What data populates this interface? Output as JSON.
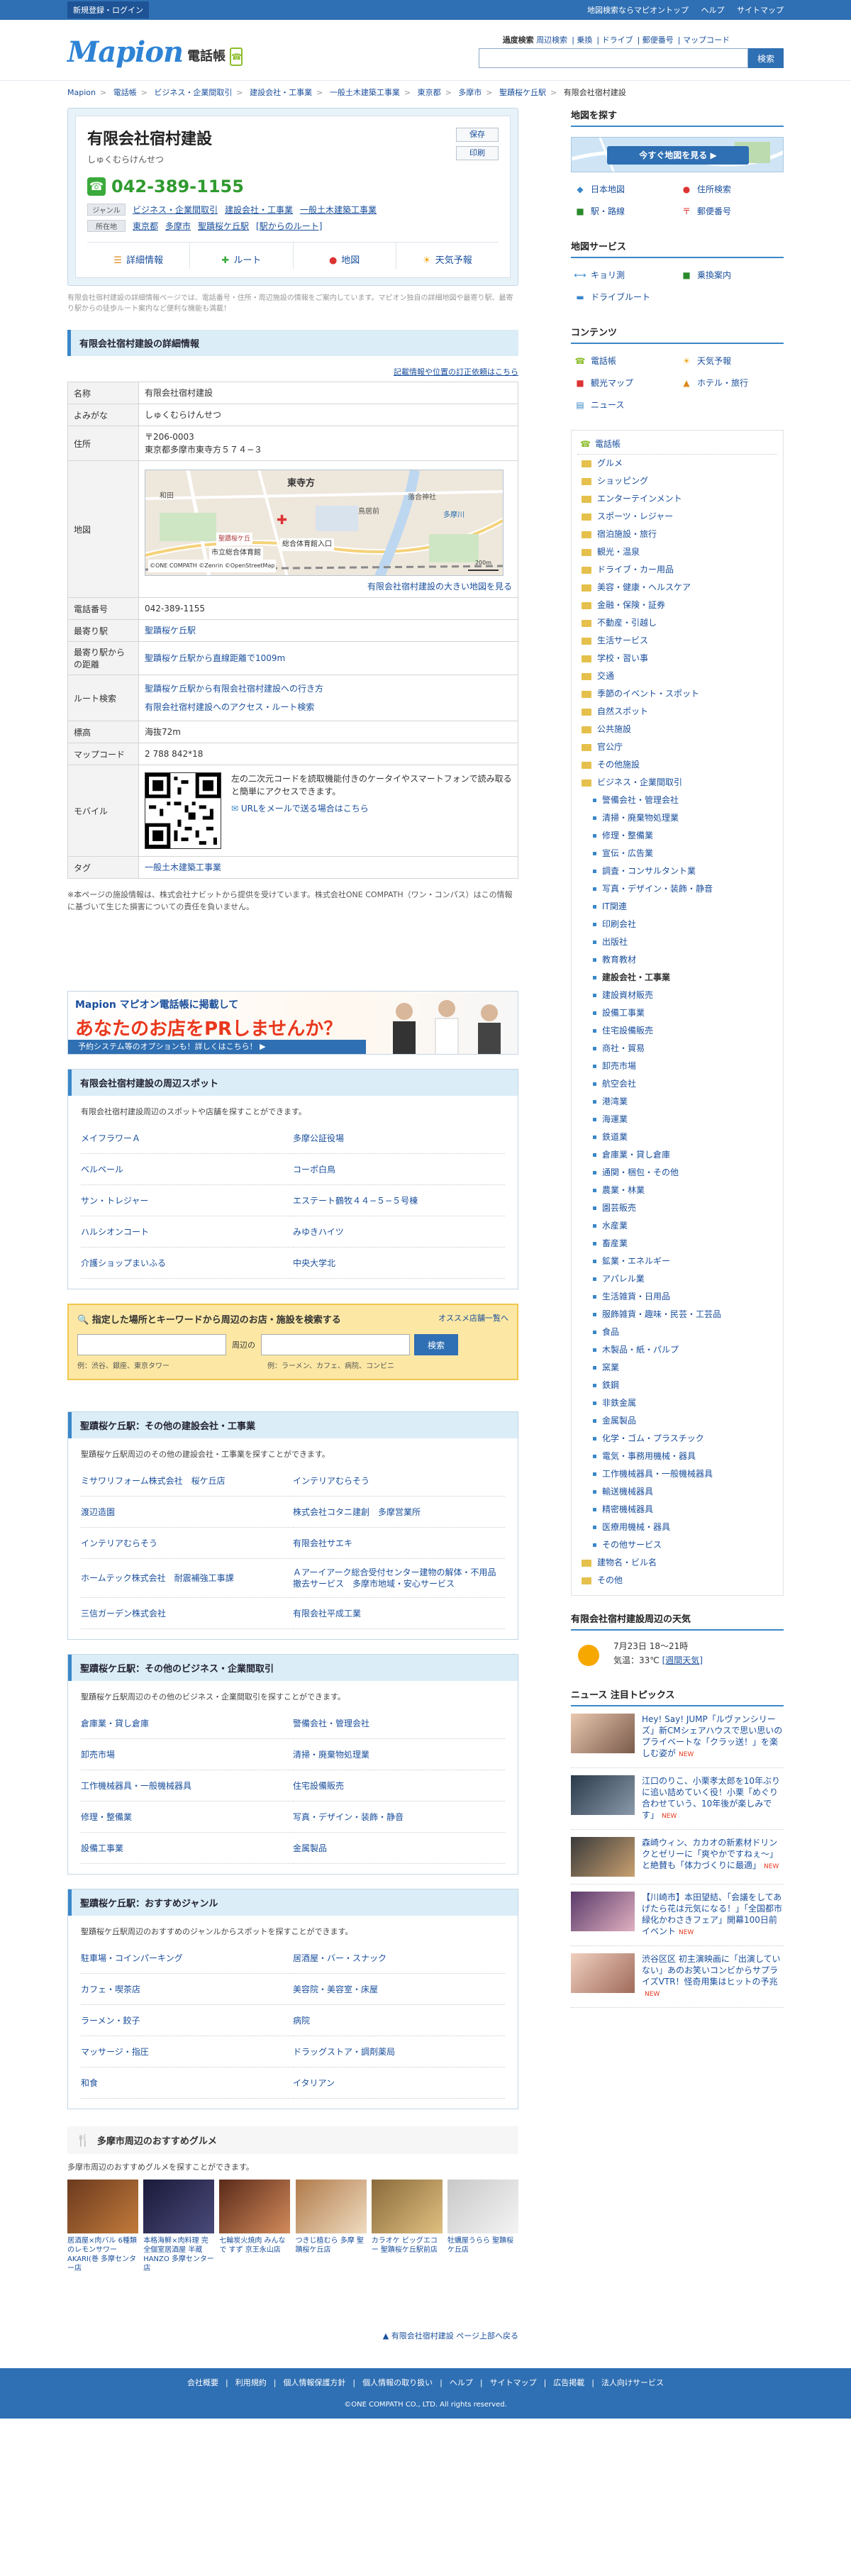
{
  "topbar": {
    "login": "新規登録・ログイン",
    "links": [
      "地図検索ならマピオントップ",
      "ヘルプ",
      "サイトマップ"
    ]
  },
  "header": {
    "logo": "Mapion",
    "logo_sub": "電話帳",
    "links_label": "過度検索",
    "links": [
      "周辺検索",
      "乗換",
      "ドライブ",
      "郵便番号",
      "マップコード"
    ],
    "search_placeholder": "",
    "search_button": "検索"
  },
  "breadcrumb": [
    "Mapion",
    "電話帳",
    "ビジネス・企業間取引",
    "建設会社・工事業",
    "一般土木建築工事業",
    "東京都",
    "多摩市",
    "聖蹟桜ケ丘駅",
    "有限会社宿村建設"
  ],
  "company": {
    "name": "有限会社宿村建設",
    "kana": "しゅくむらけんせつ",
    "save": "保存",
    "print": "印刷",
    "tel": "042-389-1155",
    "genre_tag": "ジャンル",
    "genres": [
      "ビジネス・企業間取引",
      "建設会社・工事業",
      "一般土木建築工事業"
    ],
    "address_tag": "所在地",
    "address_links": [
      "東京都",
      "多摩市",
      "聖蹟桜ケ丘駅",
      "[駅からのルート]"
    ],
    "actions": [
      "詳細情報",
      "ルート",
      "地図",
      "天気予報"
    ]
  },
  "note": "有限会社宿村建設の詳細情報ページでは、電話番号・住所・周辺施設の情報をご案内しています。マピオン独自の詳細地図や最寄り駅、最寄り駅からの徒歩ルート案内など便利な機能も満載！",
  "detail": {
    "title": "有限会社宿村建設の詳細情報",
    "correction_link": "記載情報や位置の訂正依頼はこちら",
    "rows": {
      "name_label": "名称",
      "name": "有限会社宿村建設",
      "kana_label": "よみがな",
      "kana": "しゅくむらけんせつ",
      "addr_label": "住所",
      "zip": "〒206-0003",
      "addr": "東京都多摩市東寺方５７４−３",
      "map_label": "地図",
      "map_link": "有限会社宿村建設の大きい地図を見る",
      "map_place1": "東寺方",
      "map_place2": "鳥居前",
      "map_place3": "落合神社",
      "map_place4": "多摩川",
      "map_place5": "和田",
      "map_pin": "東寺方",
      "map_route": "聖蹟桜ケ丘",
      "map_poi1": "市立総合体育館",
      "map_poi2": "総合体育館入口",
      "map_copy": "©ONE COMPATH ©Zenrin ©OpenStreetMap",
      "map_scale": "200m",
      "tel_label": "電話番号",
      "tel": "042-389-1155",
      "station_label": "最寄り駅",
      "station": "聖蹟桜ケ丘駅",
      "dist_label": "最寄り駅からの距離",
      "dist": "聖蹟桜ケ丘駅から直線距離で1009m",
      "route_label": "ルート検索",
      "route1": "聖蹟桜ケ丘駅から有限会社宿村建設への行き方",
      "route2": "有限会社宿村建設へのアクセス・ルート検索",
      "alt_label": "標高",
      "alt": "海抜72m",
      "mapcode_label": "マップコード",
      "mapcode": "2 788 842*18",
      "mobile_label": "モバイル",
      "mobile_text": "左の二次元コードを読取機能付きのケータイやスマートフォンで読み取ると簡単にアクセスできます。",
      "mobile_mail": "URLをメールで送る場合はこちら",
      "tag_label": "タグ",
      "tag": "一般土木建築工事業"
    }
  },
  "disclaimer": "※本ページの施設情報は、株式会社ナビットから提供を受けています。株式会社ONE COMPATH（ワン・コンパス）はこの情報に基づいて生じた損害についての責任を負いません。",
  "pr": {
    "line1": "Mapion マピオン電話帳に掲載して",
    "line2": "あなたのお店をPRしませんか？",
    "line3": "予約システム等のオプションも！詳しくはこちら！ ▶"
  },
  "spots": {
    "title": "有限会社宿村建設の周辺スポット",
    "desc": "有限会社宿村建設周辺のスポットや店舗を探すことができます。",
    "items": [
      "メイフラワーＡ",
      "多摩公証役場",
      "ベルペール",
      "コーポ白鳥",
      "サン・トレジャー",
      "エステート鶴牧４４−５−５号棟",
      "ハルシオンコート",
      "みゆきハイツ",
      "介護ショップまいふる",
      "中央大学北"
    ]
  },
  "search": {
    "title": "指定した場所とキーワードから周辺のお店・施設を検索する",
    "more": "オススメ店舗一覧へ",
    "near": "周辺の",
    "button": "検索",
    "ex1": "例：渋谷、銀座、東京タワー",
    "ex2": "例：ラーメン、カフェ、病院、コンビニ"
  },
  "others_build": {
    "title": "聖蹟桜ケ丘駅：その他の建設会社・工事業",
    "desc": "聖蹟桜ケ丘駅周辺のその他の建設会社・工事業を探すことができます。",
    "items": [
      "ミサワリフォーム株式会社　桜ケ丘店",
      "インテリアむらそう",
      "渡辺造園",
      "株式会社コタニ建創　多摩営業所",
      "インテリアむらそう",
      "有限会社サエキ",
      "ホームテック株式会社　耐震補強工事課",
      "Ａアーイアーク総合受付センター建物の解体・不用品撤去サービス　多摩市地域・安心サービス",
      "三信ガーデン株式会社",
      "有限会社平成工業"
    ]
  },
  "others_biz": {
    "title": "聖蹟桜ケ丘駅：その他のビジネス・企業間取引",
    "desc": "聖蹟桜ケ丘駅周辺のその他のビジネス・企業間取引を探すことができます。",
    "items": [
      "倉庫業・貸し倉庫",
      "警備会社・管理会社",
      "卸売市場",
      "清掃・廃棄物処理業",
      "工作機械器具・一般機械器具",
      "住宅設備販売",
      "修理・整備業",
      "写真・デザイン・装飾・静音",
      "設備工事業",
      "金属製品"
    ]
  },
  "recommend": {
    "title": "聖蹟桜ケ丘駅：おすすめジャンル",
    "desc": "聖蹟桜ケ丘駅周辺のおすすめのジャンルからスポットを探すことができます。",
    "items": [
      "駐車場・コインパーキング",
      "居酒屋・バー・スナック",
      "カフェ・喫茶店",
      "美容院・美容室・床屋",
      "ラーメン・餃子",
      "病院",
      "マッサージ・指圧",
      "ドラッグストア・調剤薬局",
      "和食",
      "イタリアン"
    ]
  },
  "gourmet": {
    "title": "多摩市周辺のおすすめグルメ",
    "desc": "多摩市周辺のおすすめグルメを探すことができます。",
    "items": [
      "居酒屋×肉バル 6種類のレモンサワー AKARI(巻 多摩センター店",
      "本格海鮮×肉料理 完全個室居酒屋 半蔵 HANZO 多摩センター店",
      "七輪炭火焼肉 みんなで すず 京王永山店",
      "つきじ植むら 多摩 聖蹟桜ケ丘店",
      "カラオケ ビッグエコー 聖蹟桜ケ丘駅前店",
      "牡蠣屋うらら 聖蹟桜ケ丘店"
    ]
  },
  "pagetop": "有限会社宿村建設 ページ上部へ戻る",
  "side": {
    "map_title": "地図を探す",
    "map_button": "今すぐ地図を見る ▶",
    "map_links": [
      "日本地図",
      "住所検索",
      "駅・路線",
      "郵便番号"
    ],
    "service_title": "地図サービス",
    "service_links": [
      "キョリ測",
      "乗換案内",
      "ドライブルート"
    ],
    "content_title": "コンテンツ",
    "content_links": [
      "電話帳",
      "天気予報",
      "観光マップ",
      "ホテル・旅行",
      "ニュース"
    ],
    "genre_top": "電話帳",
    "genres": [
      "グルメ",
      "ショッピング",
      "エンターテインメント",
      "スポーツ・レジャー",
      "宿泊施設・旅行",
      "観光・温泉",
      "ドライブ・カー用品",
      "美容・健康・ヘルスケア",
      "金融・保険・証券",
      "不動産・引越し",
      "生活サービス",
      "学校・習い事",
      "交通",
      "季節のイベント・スポット",
      "自然スポット",
      "公共施設",
      "官公庁",
      "その他施設",
      "ビジネス・企業間取引"
    ],
    "genre_subs": [
      "警備会社・管理会社",
      "清掃・廃棄物処理業",
      "修理・整備業",
      "宣伝・広告業",
      "調査・コンサルタント業",
      "写真・デザイン・装飾・静音",
      "IT関連",
      "印刷会社",
      "出版社",
      "教育教材",
      "建設会社・工事業",
      "建設資材販売",
      "設備工事業",
      "住宅設備販売",
      "商社・貿易",
      "卸売市場",
      "航空会社",
      "港湾業",
      "海運業",
      "鉄道業",
      "倉庫業・貸し倉庫",
      "通関・梱包・その他",
      "農業・林業",
      "園芸販売",
      "水産業",
      "畜産業",
      "鉱業・エネルギー",
      "アパレル業",
      "生活雑貨・日用品",
      "服飾雑貨・趣味・民芸・工芸品",
      "食品",
      "木製品・紙・パルプ",
      "窯業",
      "鉄鋼",
      "非鉄金属",
      "金属製品",
      "化学・ゴム・プラスチック",
      "電気・事務用機械・器具",
      "工作機械器具・一般機械器具",
      "輸送機械器具",
      "精密機械器具",
      "医療用機械・器具",
      "その他サービス"
    ],
    "genre_tail": [
      "建物名・ビル名",
      "その他"
    ],
    "weather_title": "有限会社宿村建設周辺の天気",
    "weather_line1": "7月23日 18〜21時",
    "weather_line2": "気温：33℃",
    "weather_more": "[週間天気]",
    "news_title": "ニュース 注目トピックス",
    "news": [
      {
        "text": "Hey! Say! JUMP「ルヴァンシリーズ」新CMシェアハウスで思い思いのプライベートな「クラッ送！」を楽しむ姿が",
        "new": "NEW"
      },
      {
        "text": "江口のりこ、小栗孝太郎を10年ぶりに追い詰めていく役！小栗「めぐり合わせていう、10年後が楽しみです」",
        "new": "NEW"
      },
      {
        "text": "森崎ウィン、カカオの新素材ドリンクとゼリーに「爽やかですねぇ〜」と絶賛も「体力づくりに最適」",
        "new": "NEW"
      },
      {
        "text": "【川崎市】本田望結、「会議をしてあげたら花は元気になる！」「全国都市緑化かわさきフェア」開幕100日前イベント",
        "new": "NEW"
      },
      {
        "text": "渋谷区区 初主演映画に「出演していない」あのお笑いコンビからサプライズVTR！怪奇用集はヒットの予兆",
        "new": "NEW"
      }
    ]
  },
  "footer": {
    "links": [
      "会社概要",
      "利用規約",
      "個人情報保護方針",
      "個人情報の取り扱い",
      "ヘルプ",
      "サイトマップ",
      "広告掲載",
      "法人向けサービス"
    ],
    "copy": "©ONE COMPATH CO., LTD. All rights reserved."
  }
}
